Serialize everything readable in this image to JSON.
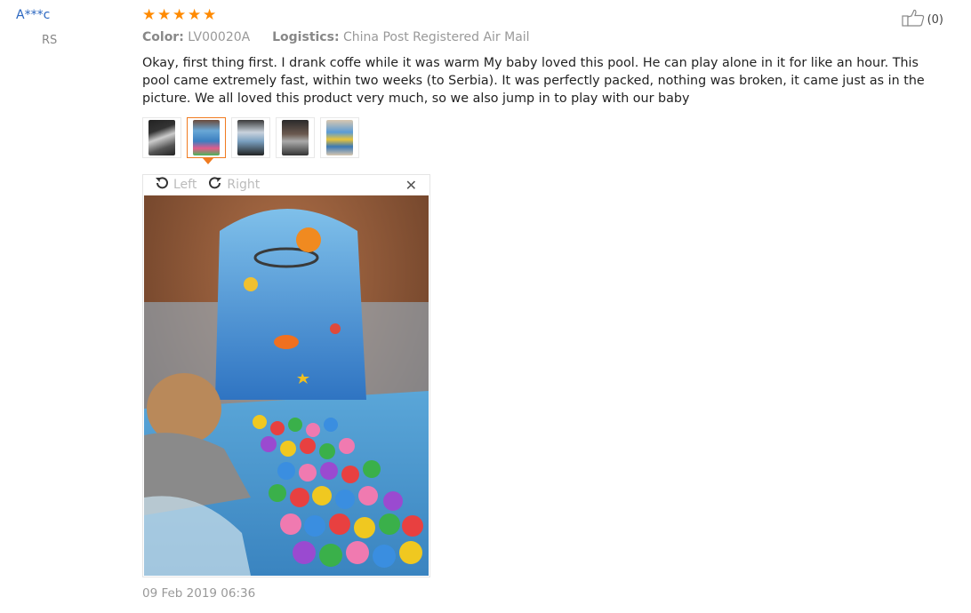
{
  "reviewer": {
    "name": "A***c",
    "country": "RS"
  },
  "rating": {
    "stars": 5,
    "max": 5,
    "color": "#ff8a00"
  },
  "meta": {
    "color_label": "Color:",
    "color_value": "LV00020A",
    "logistics_label": "Logistics:",
    "logistics_value": "China Post Registered Air Mail"
  },
  "helpful": {
    "count": "(0)",
    "icon": "thumbs-up-icon"
  },
  "review_text": "Okay, first thing first. I drank coffe while it was warm My baby loved this pool. He can play alone in it for like an hour. This pool came extremely fast, within two weeks (to Serbia). It was perfectly packed, nothing was broken, it came just as in the picture. We all loved this product very much, so we also jump in to play with our baby",
  "thumbnails": [
    {
      "name": "thumb-1",
      "active": false
    },
    {
      "name": "thumb-2",
      "active": true
    },
    {
      "name": "thumb-3",
      "active": false
    },
    {
      "name": "thumb-4",
      "active": false
    },
    {
      "name": "thumb-5",
      "active": false
    }
  ],
  "viewer": {
    "rotate_left_label": "Left",
    "rotate_right_label": "Right",
    "close_icon": "close-icon"
  },
  "date": "09 Feb 2019 06:36"
}
